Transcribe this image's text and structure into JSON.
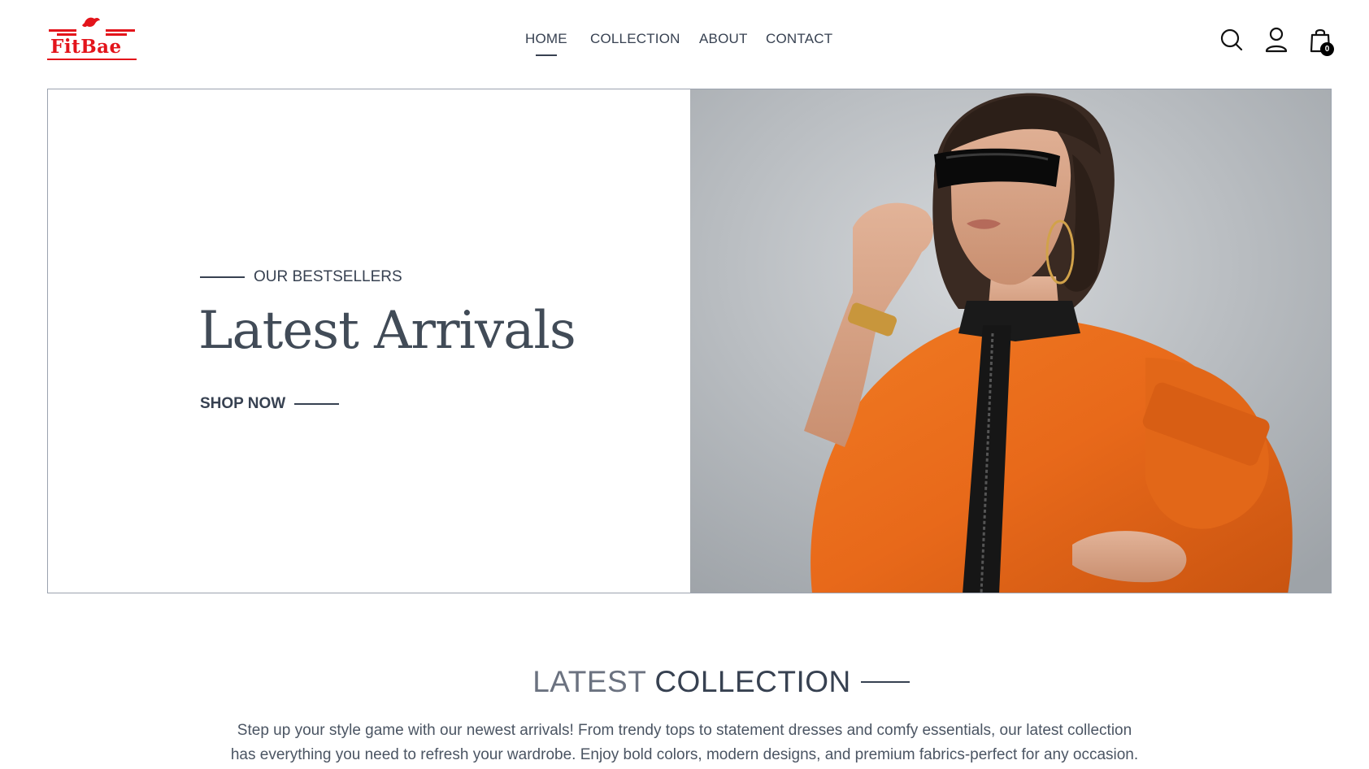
{
  "brand": {
    "name": "FitBae",
    "color": "#e3141b"
  },
  "nav": {
    "items": [
      {
        "label": "HOME",
        "active": true
      },
      {
        "label": "COLLECTION",
        "active": false
      },
      {
        "label": "ABOUT",
        "active": false
      },
      {
        "label": "CONTACT",
        "active": false
      }
    ]
  },
  "header_icons": {
    "search": "search-icon",
    "profile": "user-icon",
    "cart": "shopping-bag-icon",
    "cart_count": "0"
  },
  "hero": {
    "eyebrow": "OUR BESTSELLERS",
    "title": "Latest Arrivals",
    "cta": "SHOP NOW",
    "image_alt": "Model in orange jacket and black visor sunglasses"
  },
  "collection": {
    "title_light": "LATEST",
    "title_dark": "COLLECTION",
    "description_line1": "Step up your style game with our newest arrivals! From trendy tops to statement dresses and comfy essentials, our latest collection",
    "description_line2": "has everything you need to refresh your wardrobe. Enjoy bold colors, modern designs, and premium fabrics-perfect for any occasion."
  }
}
